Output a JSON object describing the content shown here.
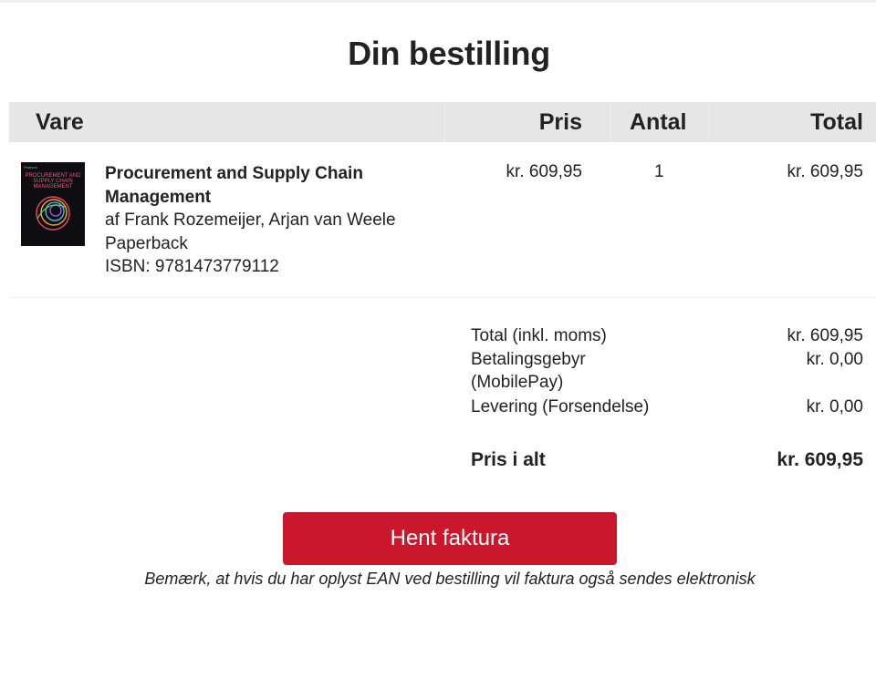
{
  "page": {
    "title": "Din bestilling"
  },
  "table": {
    "headers": {
      "vare": "Vare",
      "pris": "Pris",
      "antal": "Antal",
      "total": "Total"
    },
    "items": [
      {
        "cover": {
          "brand": "Pearson",
          "title": "PROCUREMENT AND SUPPLY CHAIN MANAGEMENT"
        },
        "title": "Procurement and Supply Chain Management",
        "author": "af Frank Rozemeijer, Arjan van Weele",
        "format": "Paperback",
        "isbn": "ISBN: 9781473779112",
        "price": "kr. 609,95",
        "quantity": "1",
        "total": "kr. 609,95"
      }
    ]
  },
  "summary": {
    "total_label": "Total (inkl. moms)",
    "total_value": "kr. 609,95",
    "fee_label": "Betalingsgebyr (MobilePay)",
    "fee_value": "kr. 0,00",
    "delivery_label": "Levering (Forsendelse)",
    "delivery_value": "kr. 0,00",
    "grand_label": "Pris i alt",
    "grand_value": "kr. 609,95"
  },
  "actions": {
    "invoice_button": "Hent faktura"
  },
  "note": "Bemærk, at hvis du har oplyst EAN ved bestilling vil faktura også sendes elektronisk",
  "colors": {
    "accent": "#c9182b",
    "header_bg": "#e6e6e6"
  }
}
